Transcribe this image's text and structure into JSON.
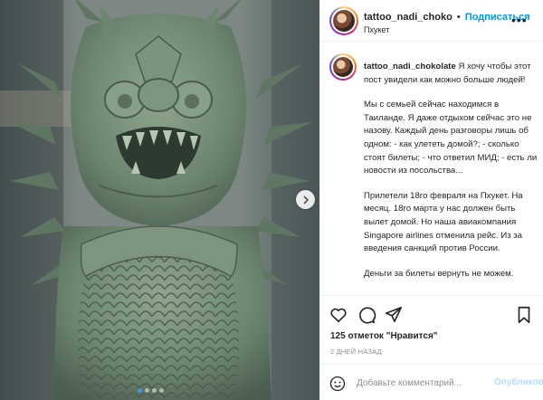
{
  "post": {
    "header": {
      "username": "tattoo_nadi_choko",
      "separator": "•",
      "follow_label": "Подписаться",
      "location": "Пхукет",
      "more_icon": "more-horizontal-icon"
    },
    "caption": {
      "username": "tattoo_nadi_chokolate",
      "first_line": "Я хочу чтобы этот пост увидели как можно больше людей!",
      "paragraphs": [
        "Мы с семьей сейчас находимся в Таиланде. Я даже отдыхом сейчас это не назову. Каждый день разговоры лишь об одном: - как улететь домой?; - сколько стоят билеты; - что ответил МИД; - есть ли новости из посольства...",
        "Прилетели 18го февраля на Пхукет. На месяц. 18го марта у нас должен быть вылет домой. Но наша авиакомпания Singapore airlines отменила рейс. Из за введения санкций против России.",
        "Деньги за билеты вернуть не можем."
      ]
    },
    "actions": {
      "like_icon": "heart-icon",
      "comment_icon": "comment-icon",
      "share_icon": "share-icon",
      "save_icon": "bookmark-icon"
    },
    "likes_text": "125 отметок \"Нравится\"",
    "timestamp": "2 ДНЕЙ НАЗАД",
    "comment": {
      "emoji_icon": "emoji-icon",
      "placeholder": "Добавьте комментарий...",
      "value": "",
      "publish_label": "Опубликовать"
    },
    "carousel": {
      "current": 1,
      "total": 4,
      "next_icon": "chevron-right-icon"
    }
  },
  "colors": {
    "accent": "#0095f6",
    "publish_disabled": "#b3dbff",
    "border": "#efefef",
    "muted": "#8e8e8e"
  }
}
